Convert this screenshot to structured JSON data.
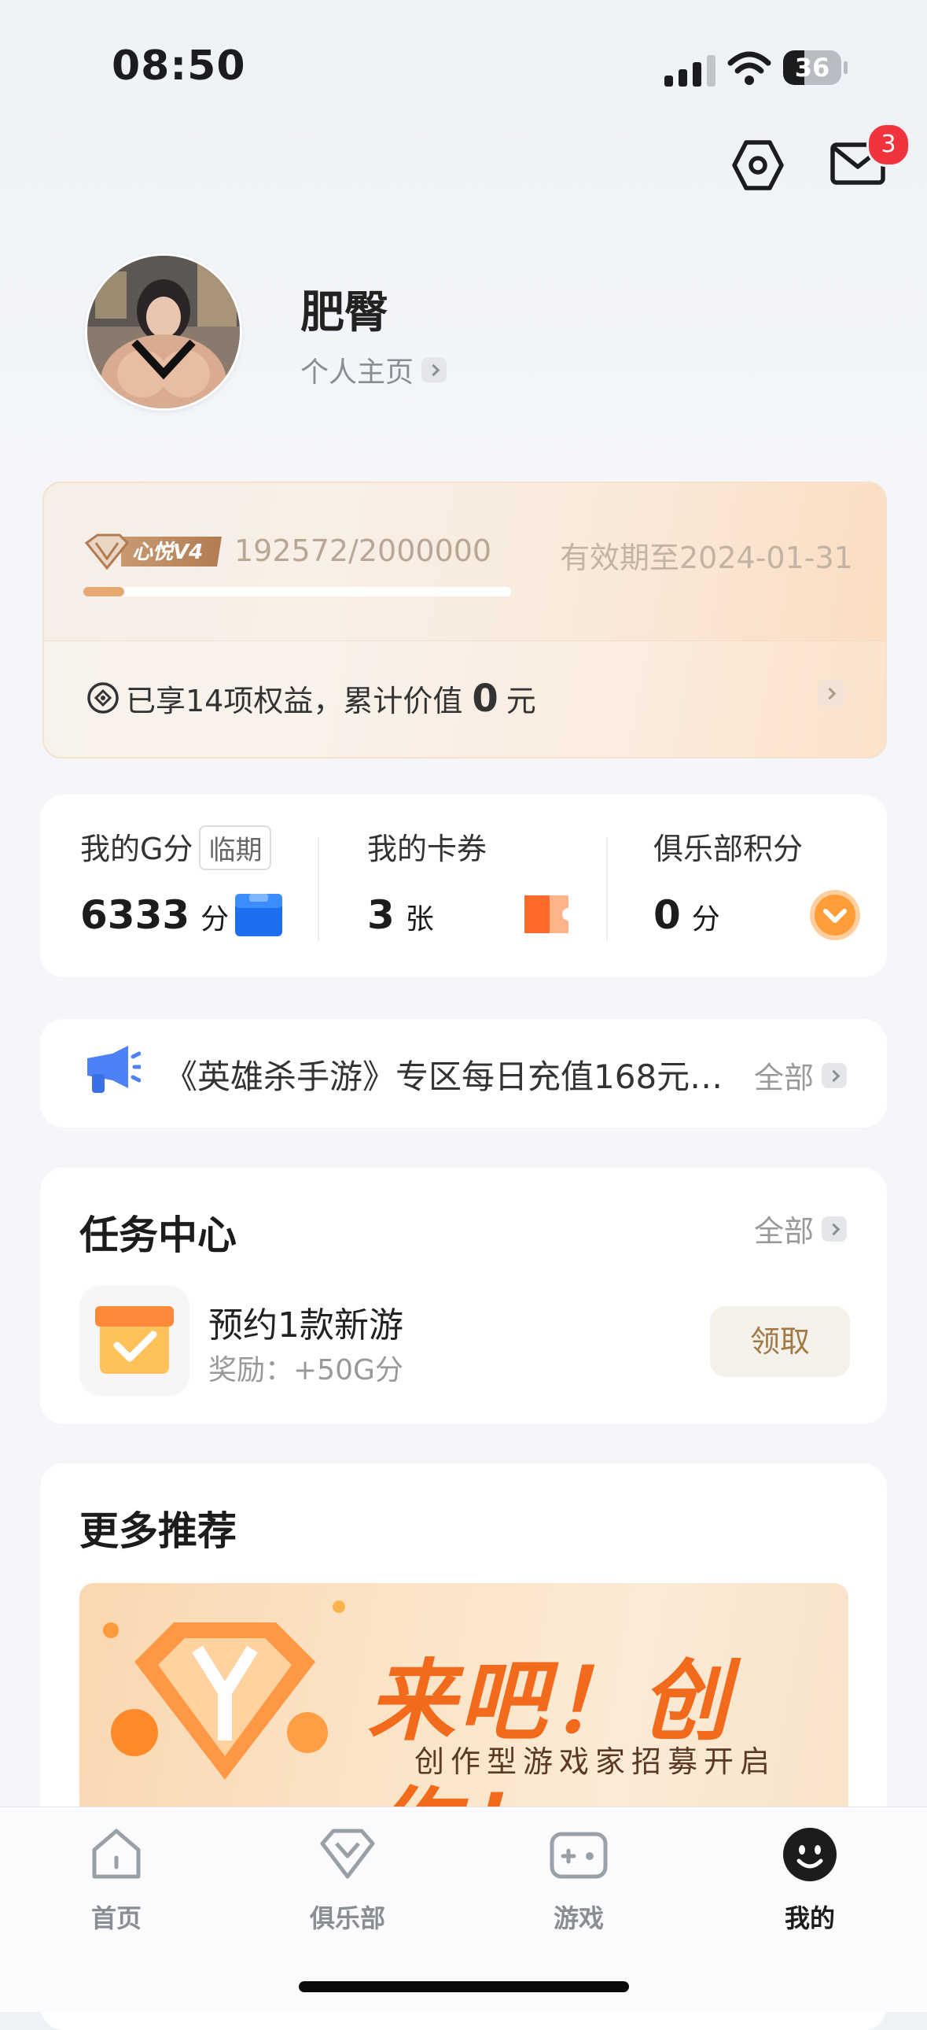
{
  "status_bar": {
    "time": "08:50",
    "battery": "36",
    "battery_level": 0.36
  },
  "header": {
    "mail_badge": "3"
  },
  "profile": {
    "username": "肥臀",
    "homepage_label": "个人主页"
  },
  "vip": {
    "badge_text": "心悦V4",
    "progress_text": "192572/2000000",
    "progress_fraction": 0.096,
    "expire_text": "有效期至2024-01-31",
    "benefit_prefix": "已享14项权益，累计价值",
    "benefit_value": "0",
    "benefit_unit": "元"
  },
  "points": {
    "g_points": {
      "title": "我的G分",
      "tag": "临期",
      "value": "6333",
      "unit": "分"
    },
    "coupons": {
      "title": "我的卡券",
      "value": "3",
      "unit": "张"
    },
    "club_points": {
      "title": "俱乐部积分",
      "value": "0",
      "unit": "分"
    }
  },
  "notice": {
    "text": "《英雄杀手游》专区每日充值168元…",
    "all_label": "全部"
  },
  "task_center": {
    "title": "任务中心",
    "all_label": "全部",
    "task_name": "预约1款新游",
    "task_reward": "奖励：+50G分",
    "claim_label": "领取"
  },
  "recommend": {
    "title": "更多推荐",
    "banner_title": "来吧！创作！",
    "banner_subtitle": "创作型游戏家招募开启"
  },
  "tabs": [
    {
      "label": "首页"
    },
    {
      "label": "俱乐部"
    },
    {
      "label": "游戏"
    },
    {
      "label": "我的"
    }
  ],
  "colors": {
    "accent_orange": "#f26a1b",
    "badge_red": "#f0333c",
    "vip_gold": "#b08560"
  }
}
